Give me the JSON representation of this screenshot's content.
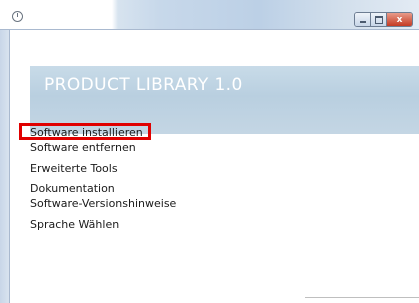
{
  "window": {
    "title": "",
    "controls": {
      "minimize": "",
      "maximize": "",
      "close": "x"
    }
  },
  "banner": {
    "title": "PRODUCT LIBRARY 1.0"
  },
  "menu": {
    "items": [
      {
        "label": "Software installieren",
        "highlighted": true
      },
      {
        "label": "Software entfernen",
        "highlighted": false
      },
      {
        "label": "Erweiterte Tools",
        "highlighted": false
      },
      {
        "label": "Dokumentation",
        "highlighted": false
      },
      {
        "label": "Software-Versionshinweise",
        "highlighted": false
      },
      {
        "label": "Sprache Wählen",
        "highlighted": false
      }
    ]
  },
  "colors": {
    "highlight": "#e00000",
    "banner": "#bcd1e2",
    "close_button": "#c43a23"
  }
}
